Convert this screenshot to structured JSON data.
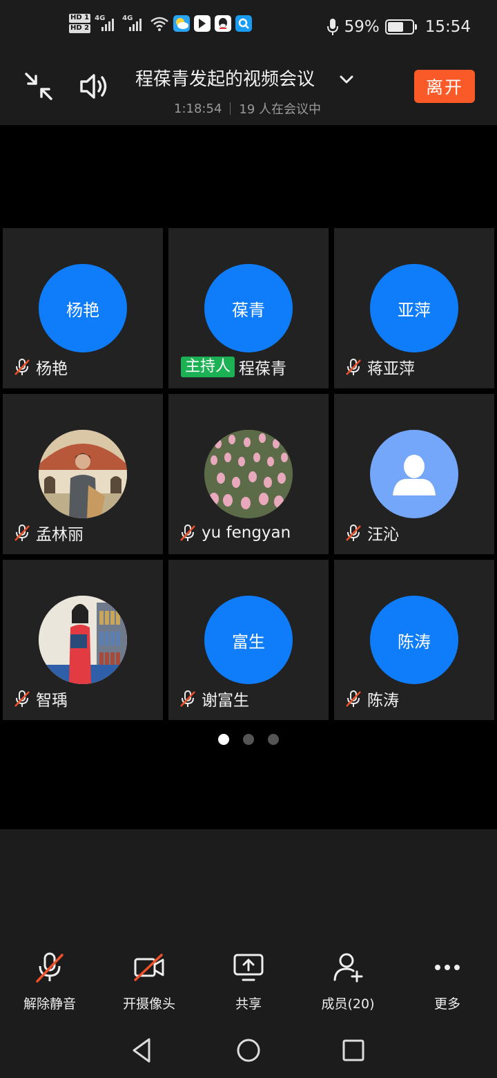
{
  "status_bar": {
    "hd1": "HD 1",
    "hd2": "HD 2",
    "net1": "4G",
    "net2": "4G",
    "battery": "59%",
    "time": "15:54",
    "icons": [
      "hd-icon",
      "signal-icon",
      "wifi-icon",
      "weather-app-icon",
      "bilibili-icon",
      "qq-icon",
      "search-app-icon",
      "mic-icon",
      "battery-icon"
    ]
  },
  "header": {
    "title": "程葆青发起的视频会议",
    "duration": "1:18:54",
    "participants": "19 人在会议中",
    "leave_label": "离开"
  },
  "participants": [
    {
      "avatar_text": "杨艳",
      "name": "杨艳",
      "muted": true
    },
    {
      "avatar_text": "葆青",
      "name": "程葆青",
      "host_badge": "主持人",
      "muted": false
    },
    {
      "avatar_text": "亚萍",
      "name": "蒋亚萍",
      "muted": true
    },
    {
      "avatar_text": "",
      "name": "孟林丽",
      "muted": true,
      "avatar_kind": "photo-building"
    },
    {
      "avatar_text": "",
      "name": "yu fengyan",
      "muted": true,
      "avatar_kind": "photo-tulips"
    },
    {
      "avatar_text": "",
      "name": "汪沁",
      "muted": true,
      "avatar_kind": "default-person"
    },
    {
      "avatar_text": "",
      "name": "智瑀",
      "muted": true,
      "avatar_kind": "photo-library"
    },
    {
      "avatar_text": "富生",
      "name": "谢富生",
      "muted": true
    },
    {
      "avatar_text": "陈涛",
      "name": "陈涛",
      "muted": true
    }
  ],
  "pagination": {
    "pages": 3,
    "current": 1
  },
  "toolbar": {
    "unmute": "解除静音",
    "camera": "开摄像头",
    "share": "共享",
    "members": "成员(20)",
    "more": "更多"
  },
  "colors": {
    "accent_blue": "#0f7dfa",
    "leave_orange": "#fa5a28",
    "host_green": "#1bb154",
    "mute_red": "#f0502a"
  }
}
